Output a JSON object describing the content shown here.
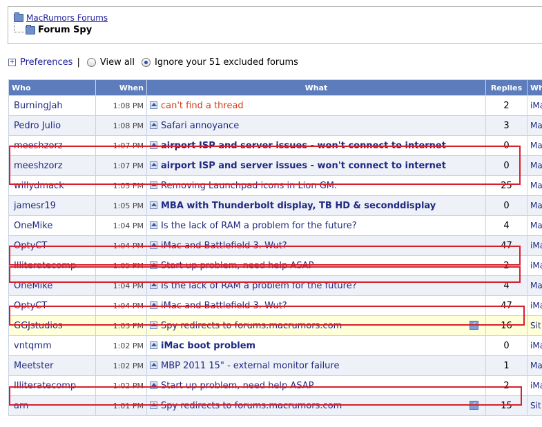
{
  "nav": {
    "parent": "MacRumors Forums",
    "current": "Forum Spy"
  },
  "prefs": {
    "link": "Preferences",
    "sep": "|",
    "view_all": "View all",
    "ignore": "Ignore your 51 excluded forums"
  },
  "table": {
    "headers": {
      "who": "Who",
      "when": "When",
      "what": "What",
      "replies": "Replies",
      "where": "Whe"
    },
    "rows": [
      {
        "who": "BurningJah",
        "when": "1:08 PM",
        "what": "can't find a thread",
        "replies": "2",
        "where": "iMa"
      },
      {
        "who": "Pedro Julio",
        "when": "1:08 PM",
        "what": "Safari annoyance",
        "replies": "3",
        "where": "Ma Sto"
      },
      {
        "who": "meeshzorz",
        "when": "1:07 PM",
        "what": "airport ISP and server issues - won't connect to internet",
        "replies": "0",
        "where": "Ma"
      },
      {
        "who": "meeshzorz",
        "when": "1:07 PM",
        "what": "airport ISP and server issues - won't connect to internet",
        "replies": "0",
        "where": "Ma"
      },
      {
        "who": "willydmack",
        "when": "1:05 PM",
        "what": "Removing Launchpad icons in Lion GM.",
        "replies": "25",
        "where": "Ma"
      },
      {
        "who": "jamesr19",
        "when": "1:05 PM",
        "what": "MBA with Thunderbolt display, TB HD & seconddisplay",
        "replies": "0",
        "where": "Ma"
      },
      {
        "who": "OneMike",
        "when": "1:04 PM",
        "what": "Is the lack of RAM a problem for the future?",
        "replies": "4",
        "where": "Ma"
      },
      {
        "who": "OptyCT",
        "when": "1:04 PM",
        "what": "iMac and Battlefield 3. Wut?",
        "replies": "47",
        "where": "iMa"
      },
      {
        "who": "Illiteratecomp",
        "when": "1:05 PM",
        "what": "Start up problem, need help ASAP",
        "replies": "2",
        "where": "iMa"
      },
      {
        "who": "OneMike",
        "when": "1:04 PM",
        "what": "Is the lack of RAM a problem for the future?",
        "replies": "4",
        "where": "Ma"
      },
      {
        "who": "OptyCT",
        "when": "1:04 PM",
        "what": "iMac and Battlefield 3. Wut?",
        "replies": "47",
        "where": "iMa"
      },
      {
        "who": "GGJstudios",
        "when": "1:03 PM",
        "what": "Spy redirects to forums.macrumors.com",
        "replies": "16",
        "where": "Sit"
      },
      {
        "who": "vntqmm",
        "when": "1:02 PM",
        "what": "iMac boot problem",
        "replies": "0",
        "where": "iMa"
      },
      {
        "who": "Meetster",
        "when": "1:02 PM",
        "what": "MBP 2011 15\" - external monitor failure",
        "replies": "1",
        "where": "Ma"
      },
      {
        "who": "Illiteratecomp",
        "when": "1:02 PM",
        "what": "Start up problem, need help ASAP",
        "replies": "2",
        "where": "iMa"
      },
      {
        "who": "arn",
        "when": "1:01 PM",
        "what": "Spy redirects to forums.macrumors.com",
        "replies": "15",
        "where": "Sit"
      }
    ]
  },
  "colors": {
    "header_bg": "#5d7cbb",
    "link": "#1f2a82",
    "highlight": "#d6202a",
    "sticky_bg": "#ffffd9"
  }
}
